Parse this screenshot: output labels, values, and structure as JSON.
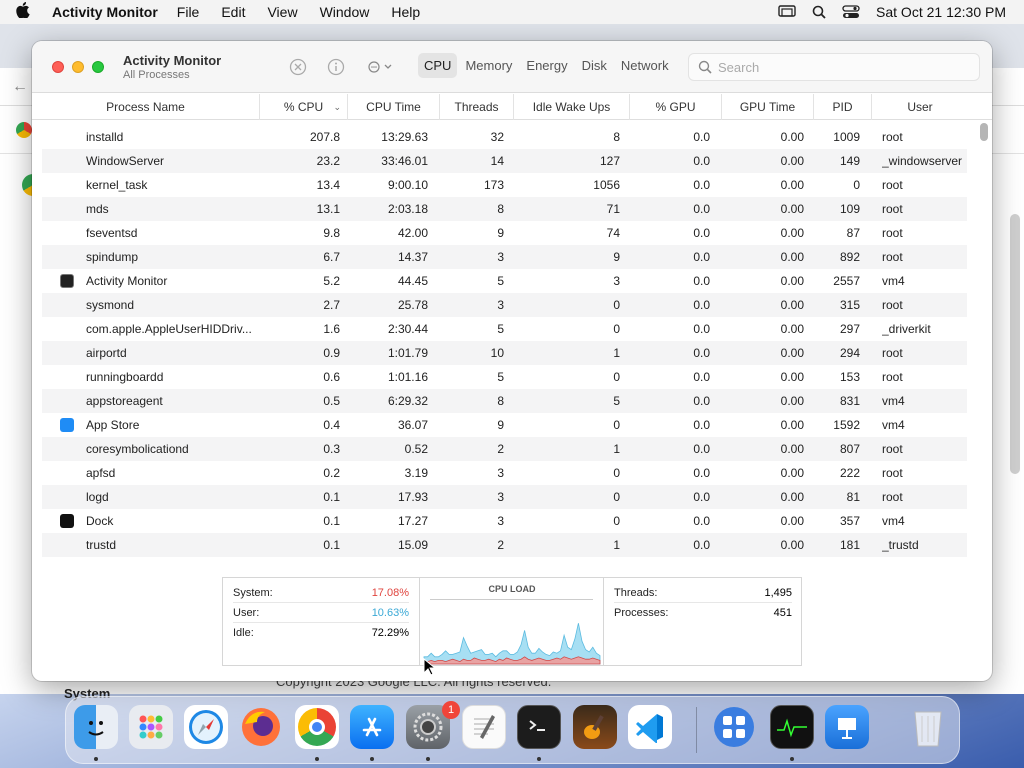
{
  "menubar": {
    "app": "Activity Monitor",
    "items": [
      "File",
      "Edit",
      "View",
      "Window",
      "Help"
    ],
    "datetime": "Sat Oct 21  12:30 PM"
  },
  "background": {
    "footer": "Copyright 2023 Google LLC. All rights reserved.",
    "system_label": "System"
  },
  "window": {
    "title": "Activity Monitor",
    "subtitle": "All Processes",
    "tabs": [
      "CPU",
      "Memory",
      "Energy",
      "Disk",
      "Network"
    ],
    "active_tab": "CPU",
    "search_placeholder": "Search"
  },
  "table": {
    "columns": [
      "Process Name",
      "% CPU",
      "CPU Time",
      "Threads",
      "Idle Wake Ups",
      "% GPU",
      "GPU Time",
      "PID",
      "User"
    ],
    "sorted_by": "% CPU",
    "rows": [
      {
        "name": "installd",
        "cpu": "207.8",
        "time": "13:29.63",
        "threads": "32",
        "idle": "8",
        "gpu": "0.0",
        "gtime": "0.00",
        "pid": "1009",
        "user": "root",
        "icon": ""
      },
      {
        "name": "WindowServer",
        "cpu": "23.2",
        "time": "33:46.01",
        "threads": "14",
        "idle": "127",
        "gpu": "0.0",
        "gtime": "0.00",
        "pid": "149",
        "user": "_windowserver",
        "icon": ""
      },
      {
        "name": "kernel_task",
        "cpu": "13.4",
        "time": "9:00.10",
        "threads": "173",
        "idle": "1056",
        "gpu": "0.0",
        "gtime": "0.00",
        "pid": "0",
        "user": "root",
        "icon": ""
      },
      {
        "name": "mds",
        "cpu": "13.1",
        "time": "2:03.18",
        "threads": "8",
        "idle": "71",
        "gpu": "0.0",
        "gtime": "0.00",
        "pid": "109",
        "user": "root",
        "icon": ""
      },
      {
        "name": "fseventsd",
        "cpu": "9.8",
        "time": "42.00",
        "threads": "9",
        "idle": "74",
        "gpu": "0.0",
        "gtime": "0.00",
        "pid": "87",
        "user": "root",
        "icon": ""
      },
      {
        "name": "spindump",
        "cpu": "6.7",
        "time": "14.37",
        "threads": "3",
        "idle": "9",
        "gpu": "0.0",
        "gtime": "0.00",
        "pid": "892",
        "user": "root",
        "icon": ""
      },
      {
        "name": "Activity Monitor",
        "cpu": "5.2",
        "time": "44.45",
        "threads": "5",
        "idle": "3",
        "gpu": "0.0",
        "gtime": "0.00",
        "pid": "2557",
        "user": "vm4",
        "icon": "activity-monitor"
      },
      {
        "name": "sysmond",
        "cpu": "2.7",
        "time": "25.78",
        "threads": "3",
        "idle": "0",
        "gpu": "0.0",
        "gtime": "0.00",
        "pid": "315",
        "user": "root",
        "icon": ""
      },
      {
        "name": "com.apple.AppleUserHIDDriv...",
        "cpu": "1.6",
        "time": "2:30.44",
        "threads": "5",
        "idle": "0",
        "gpu": "0.0",
        "gtime": "0.00",
        "pid": "297",
        "user": "_driverkit",
        "icon": ""
      },
      {
        "name": "airportd",
        "cpu": "0.9",
        "time": "1:01.79",
        "threads": "10",
        "idle": "1",
        "gpu": "0.0",
        "gtime": "0.00",
        "pid": "294",
        "user": "root",
        "icon": ""
      },
      {
        "name": "runningboardd",
        "cpu": "0.6",
        "time": "1:01.16",
        "threads": "5",
        "idle": "0",
        "gpu": "0.0",
        "gtime": "0.00",
        "pid": "153",
        "user": "root",
        "icon": ""
      },
      {
        "name": "appstoreagent",
        "cpu": "0.5",
        "time": "6:29.32",
        "threads": "8",
        "idle": "5",
        "gpu": "0.0",
        "gtime": "0.00",
        "pid": "831",
        "user": "vm4",
        "icon": ""
      },
      {
        "name": "App Store",
        "cpu": "0.4",
        "time": "36.07",
        "threads": "9",
        "idle": "0",
        "gpu": "0.0",
        "gtime": "0.00",
        "pid": "1592",
        "user": "vm4",
        "icon": "app-store"
      },
      {
        "name": "coresymbolicationd",
        "cpu": "0.3",
        "time": "0.52",
        "threads": "2",
        "idle": "1",
        "gpu": "0.0",
        "gtime": "0.00",
        "pid": "807",
        "user": "root",
        "icon": ""
      },
      {
        "name": "apfsd",
        "cpu": "0.2",
        "time": "3.19",
        "threads": "3",
        "idle": "0",
        "gpu": "0.0",
        "gtime": "0.00",
        "pid": "222",
        "user": "root",
        "icon": ""
      },
      {
        "name": "logd",
        "cpu": "0.1",
        "time": "17.93",
        "threads": "3",
        "idle": "0",
        "gpu": "0.0",
        "gtime": "0.00",
        "pid": "81",
        "user": "root",
        "icon": ""
      },
      {
        "name": "Dock",
        "cpu": "0.1",
        "time": "17.27",
        "threads": "3",
        "idle": "0",
        "gpu": "0.0",
        "gtime": "0.00",
        "pid": "357",
        "user": "vm4",
        "icon": "dock"
      },
      {
        "name": "trustd",
        "cpu": "0.1",
        "time": "15.09",
        "threads": "2",
        "idle": "1",
        "gpu": "0.0",
        "gtime": "0.00",
        "pid": "181",
        "user": "_trustd",
        "icon": ""
      }
    ]
  },
  "stats": {
    "system_label": "System:",
    "system_value": "17.08%",
    "system_color": "#e0443e",
    "user_label": "User:",
    "user_value": "10.63%",
    "user_color": "#3aa9d6",
    "idle_label": "Idle:",
    "idle_value": "72.29%",
    "chart_title": "CPU LOAD",
    "threads_label": "Threads:",
    "threads_value": "1,495",
    "processes_label": "Processes:",
    "processes_value": "451"
  },
  "cpu_load": {
    "user": [
      3,
      4,
      6,
      4,
      3,
      5,
      9,
      5,
      4,
      6,
      8,
      18,
      12,
      6,
      5,
      7,
      9,
      5,
      4,
      6,
      4,
      5,
      8,
      6,
      4,
      5,
      7,
      12,
      22,
      10,
      6,
      5,
      8,
      6,
      5,
      4,
      6,
      4,
      7,
      18,
      9,
      8,
      16,
      28,
      14,
      8,
      6,
      9,
      5,
      4
    ],
    "system": [
      3,
      2,
      3,
      2,
      3,
      3,
      2,
      3,
      4,
      3,
      2,
      4,
      3,
      3,
      5,
      4,
      3,
      3,
      4,
      3,
      2,
      4,
      3,
      5,
      4,
      3,
      3,
      4,
      6,
      4,
      3,
      4,
      5,
      4,
      3,
      3,
      4,
      5,
      4,
      6,
      5,
      4,
      5,
      6,
      5,
      4,
      4,
      5,
      4,
      3
    ]
  },
  "dock": {
    "apps": [
      "finder",
      "launchpad",
      "safari",
      "firefox",
      "chrome",
      "app-store",
      "system-settings",
      "textedit",
      "terminal",
      "garageband",
      "vscode",
      "screen-sharing",
      "activity-monitor",
      "keynote",
      "trash"
    ],
    "settings_badge": "1"
  }
}
